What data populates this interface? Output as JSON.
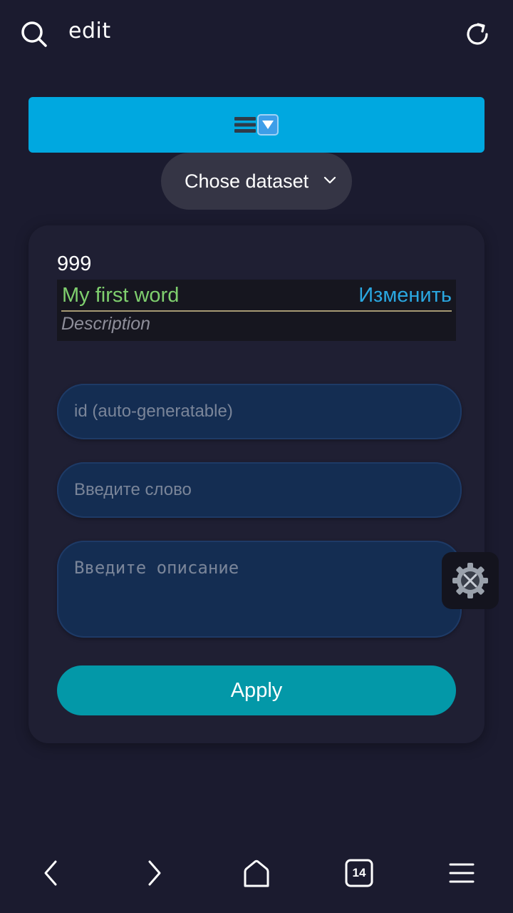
{
  "topbar": {
    "url_text": "edit",
    "search_icon": "search-icon",
    "reload_icon": "reload-icon"
  },
  "banner": {
    "icons": [
      "hamburger-icon",
      "down-arrow-box-icon"
    ],
    "color": "#00a8e0"
  },
  "dataset_select": {
    "selected": "Chose dataset"
  },
  "entry": {
    "id": "999",
    "word": "My first word",
    "edit_label": "Изменить",
    "description": "Description"
  },
  "form": {
    "id_placeholder": "id (auto-generatable)",
    "word_placeholder": "Введите слово",
    "description_placeholder": "Введите описание",
    "apply_label": "Apply"
  },
  "floating_tools": {
    "icon": "gear-tools-icon"
  },
  "bottom_nav": {
    "items": [
      "back-icon",
      "forward-icon",
      "home-icon",
      "tabs-icon",
      "menu-icon"
    ],
    "tabs_count": "14"
  },
  "colors": {
    "background": "#1b1b2f",
    "card": "#1f1f33",
    "word_green": "#7fcf6e",
    "link_blue": "#2aa7e0",
    "field_bg": "#142d52",
    "apply_teal": "#0398a8"
  }
}
